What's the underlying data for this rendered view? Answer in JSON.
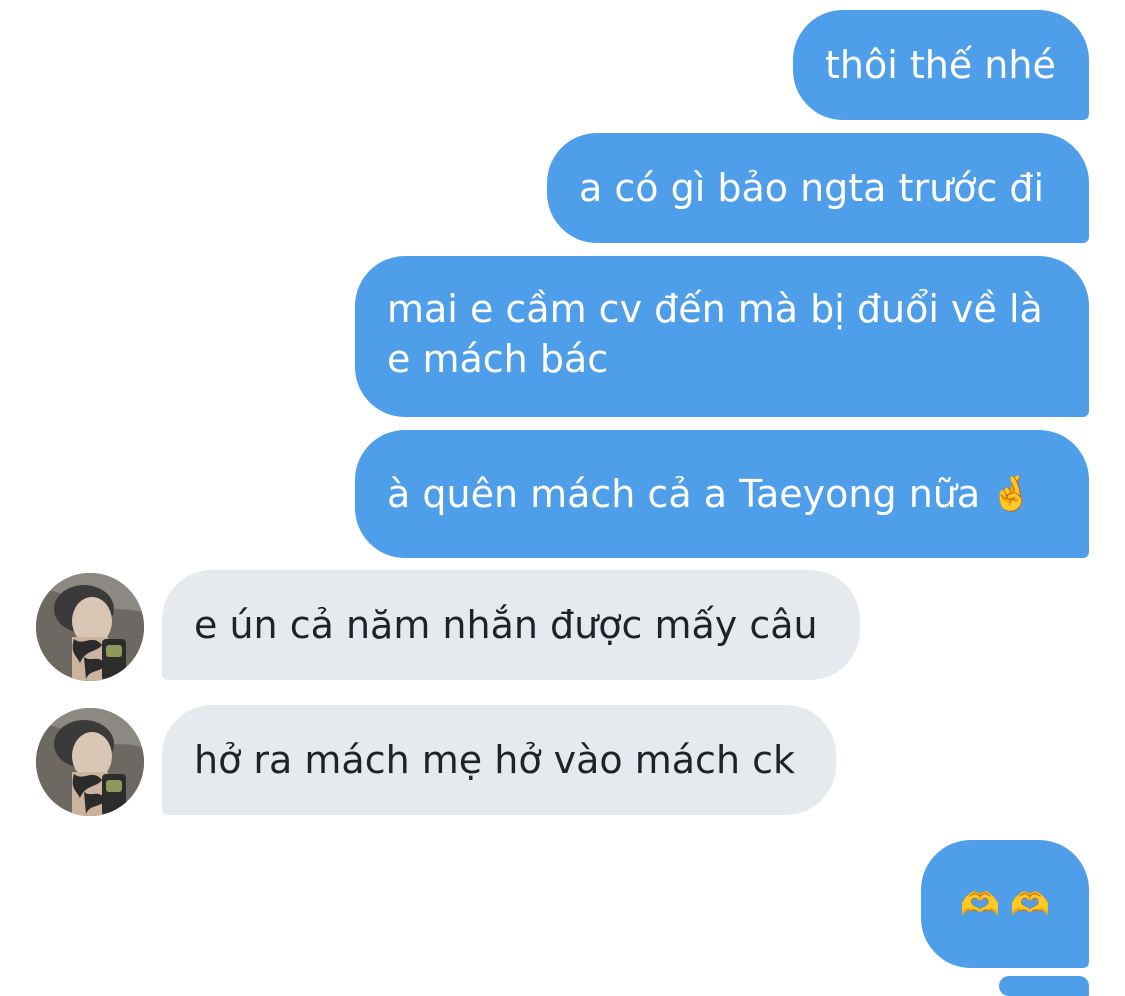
{
  "messages": [
    {
      "side": "out",
      "text": "thôi thế nhé"
    },
    {
      "side": "out",
      "text": "a có gì bảo ngta trước đi"
    },
    {
      "side": "out",
      "text": "mai e cầm cv đến mà bị đuổi về là e mách bác"
    },
    {
      "side": "out",
      "text": "à quên mách cả a Taeyong nữa",
      "emoji": "🤞"
    },
    {
      "side": "in",
      "text": "e ún cả năm nhắn được mấy câu"
    },
    {
      "side": "in",
      "text": "hở ra mách mẹ hở vào mách ck"
    },
    {
      "side": "out",
      "emoji": "🫶 🫶"
    }
  ],
  "colors": {
    "outgoing_bubble": "#4f9eea",
    "incoming_bubble": "#e6eaee",
    "outgoing_text": "#ffffff",
    "incoming_text": "#1f2328"
  },
  "icons": {
    "avatar": "contact-avatar"
  }
}
